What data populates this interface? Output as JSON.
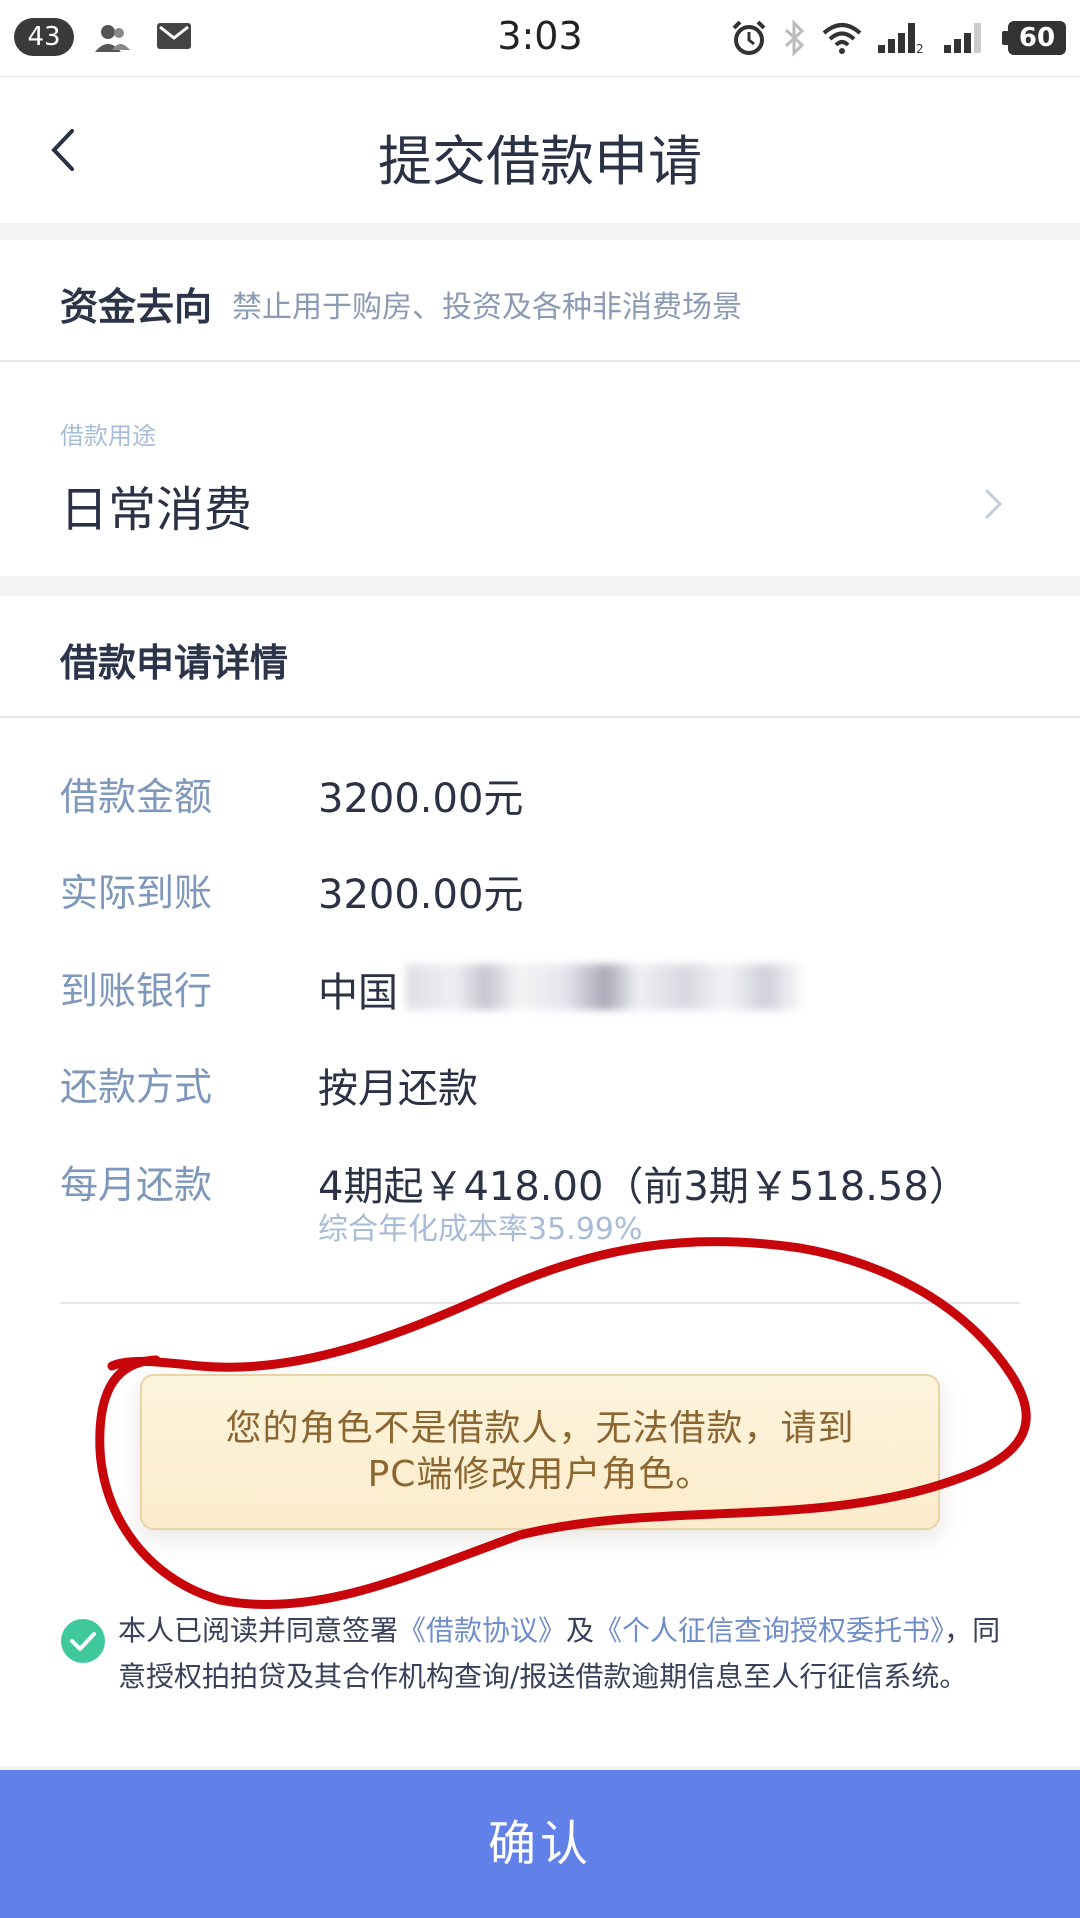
{
  "status_bar": {
    "notification_count": "43",
    "time": "3:03",
    "battery": "60",
    "icons": [
      "contacts-icon",
      "mail-icon",
      "alarm-icon",
      "bluetooth-icon",
      "wifi-icon",
      "signal-icon"
    ]
  },
  "header": {
    "title": "提交借款申请",
    "back_icon": "chevron-left-icon"
  },
  "fund_direction": {
    "label": "资金去向",
    "description": "禁止用于购房、投资及各种非消费场景"
  },
  "purpose": {
    "label": "借款用途",
    "value": "日常消费",
    "icon": "chevron-right-icon"
  },
  "details": {
    "title": "借款申请详情",
    "rows": [
      {
        "label": "借款金额",
        "value": "3200.00元"
      },
      {
        "label": "实际到账",
        "value": "3200.00元"
      },
      {
        "label": "到账银行",
        "value": "中国"
      },
      {
        "label": "还款方式",
        "value": "按月还款"
      },
      {
        "label": "每月还款",
        "value": "4期起￥418.00（前3期￥518.58）"
      }
    ],
    "rate_note": "综合年化成本率35.99%"
  },
  "toast": {
    "line1": "您的角色不是借款人，无法借款，请到",
    "line2": "PC端修改用户角色。"
  },
  "agreement": {
    "text_before": "本人已阅读并同意签署",
    "link1": "《借款协议》",
    "text_middle": "及",
    "link2": "《个人征信查询授权委托书》",
    "text_after": "，同意授权拍拍贷及其合作机构查询/报送借款逾期信息至人行征信系统。",
    "checked": true
  },
  "confirm_button": "确认",
  "colors": {
    "accent": "#6181e8",
    "check": "#3ec89b",
    "label_blue": "#7e98bc",
    "toast_text": "#8c6631",
    "annotation_red": "#c8050a"
  }
}
